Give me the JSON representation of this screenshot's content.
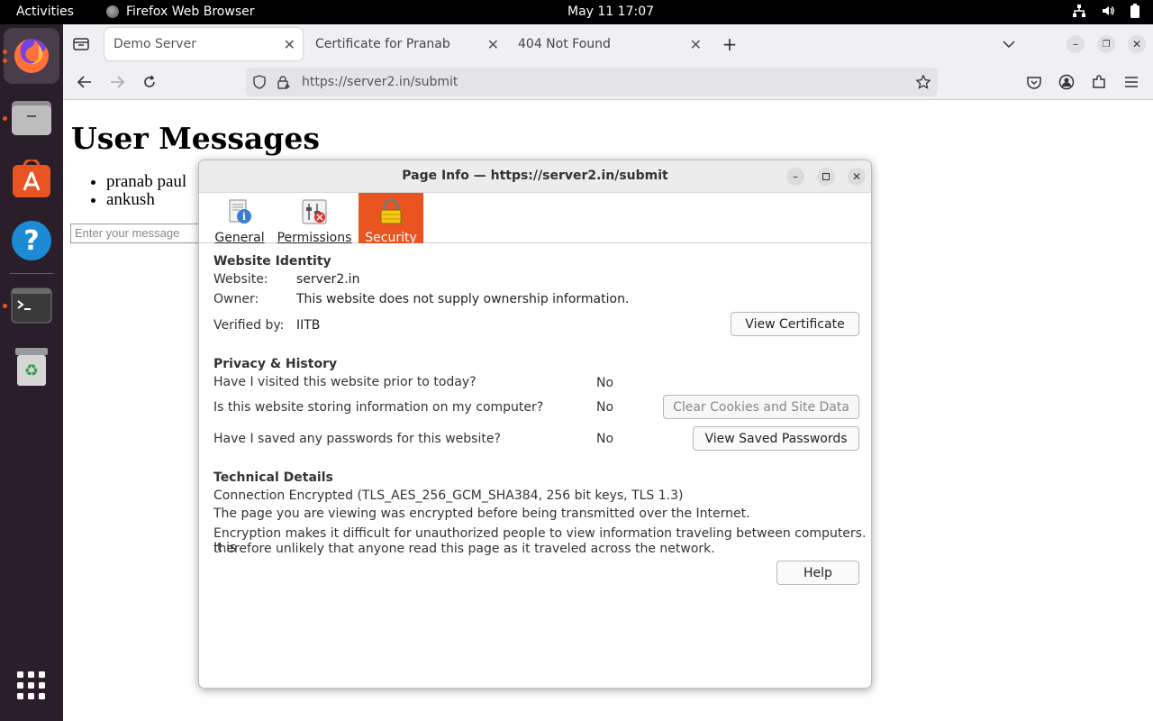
{
  "topbar": {
    "activities": "Activities",
    "app_name": "Firefox Web Browser",
    "clock": "May 11  17:07"
  },
  "dock": {
    "items": [
      "firefox-icon",
      "files-icon",
      "app-center-icon",
      "help-icon",
      "terminal-icon",
      "trash-icon",
      "show-apps-icon"
    ]
  },
  "browser": {
    "tabs": [
      {
        "label": "Demo Server"
      },
      {
        "label": "Certificate for Pranab"
      },
      {
        "label": "404 Not Found"
      }
    ],
    "url": "https://server2.in/submit"
  },
  "page": {
    "heading": "User Messages",
    "messages": [
      "pranab paul",
      "ankush"
    ],
    "input_placeholder": "Enter your message"
  },
  "dialog": {
    "title": "Page Info — https://server2.in/submit",
    "tabs": [
      {
        "label": "General"
      },
      {
        "label": "Permissions"
      },
      {
        "label": "Security"
      }
    ],
    "identity": {
      "heading": "Website Identity",
      "website_label": "Website:",
      "website_value": "server2.in",
      "owner_label": "Owner:",
      "owner_value": "This website does not supply ownership information.",
      "verified_label": "Verified by:",
      "verified_value": "IITB",
      "view_cert_button": "View Certificate"
    },
    "privacy": {
      "heading": "Privacy & History",
      "q1": "Have I visited this website prior to today?",
      "a1": "No",
      "q2": "Is this website storing information on my computer?",
      "a2": "No",
      "clear_button": "Clear Cookies and Site Data",
      "q3": "Have I saved any passwords for this website?",
      "a3": "No",
      "passwords_button": "View Saved Passwords"
    },
    "technical": {
      "heading": "Technical Details",
      "line1": "Connection Encrypted (TLS_AES_256_GCM_SHA384, 256 bit keys, TLS 1.3)",
      "line2": "The page you are viewing was encrypted before being transmitted over the Internet.",
      "line3a": "Encryption makes it difficult for unauthorized people to view information traveling between computers. It is",
      "line3b": "therefore unlikely that anyone read this page as it traveled across the network."
    },
    "help_button": "Help"
  },
  "colors": {
    "accent": "#e95420",
    "dock_bg": "#2b1e2b",
    "topbar_bg": "#000000"
  }
}
